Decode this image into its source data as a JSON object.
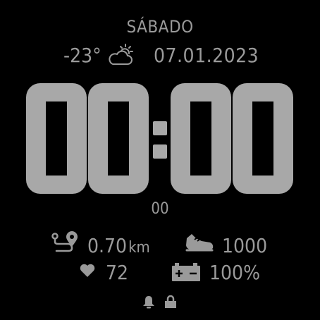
{
  "watch": {
    "day": "SÁBADO",
    "temperature": "-23°",
    "date": "07.01.2023",
    "time": {
      "h1": "0",
      "h2": "0",
      "m1": "0",
      "m2": "0"
    },
    "seconds": "00",
    "distance": {
      "value": "0.70",
      "unit": "km"
    },
    "steps": "1000",
    "heart_rate": "72",
    "battery": "100%"
  },
  "icons": {
    "weather": "partly-cloudy-icon",
    "distance": "route-pin-icon",
    "steps": "shoe-icon",
    "heart": "heart-icon",
    "battery": "battery-icon",
    "alarm": "bell-icon",
    "lock": "lock-icon"
  },
  "colors": {
    "text": "#9a9a9a",
    "digits": "#a8a8a8",
    "background": "#000000"
  }
}
